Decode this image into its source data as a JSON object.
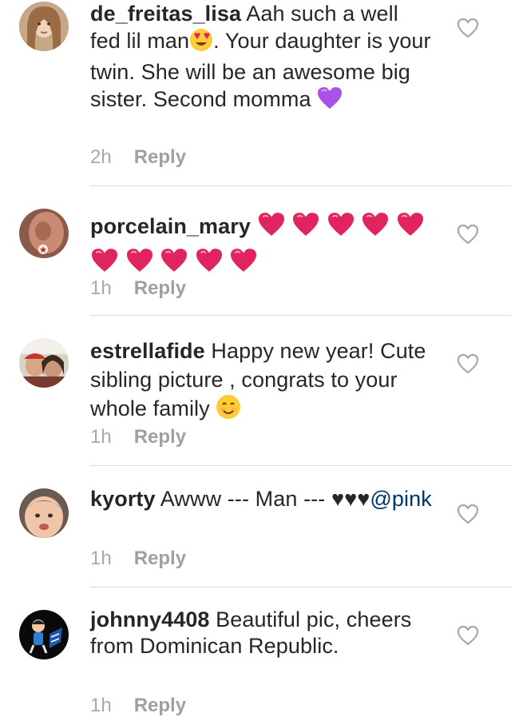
{
  "comments": [
    {
      "username": "de_freitas_lisa",
      "text_1": " Aah such a well fed lil man",
      "emoji_1": "heart-eyes-emoji",
      "text_2": ". Your daughter is your twin. She will be an awesome big sister. Second momma ",
      "emoji_2": "purple-heart-emoji",
      "time": "2h",
      "reply_label": "Reply"
    },
    {
      "username": "porcelain_mary",
      "emoji": "red-heart-emoji",
      "emoji_count": 10,
      "time": "1h",
      "reply_label": "Reply"
    },
    {
      "username": "estrellafide",
      "text": " Happy new year! Cute sibling picture , congrats to your whole family ",
      "emoji": "smiling-face-emoji",
      "time": "1h",
      "reply_label": "Reply"
    },
    {
      "username": "kyorty",
      "text": " Awww --- Man --- ",
      "hearts": "♥♥♥",
      "mention": "@pink",
      "time": "1h",
      "reply_label": "Reply"
    },
    {
      "username": "johnny4408",
      "text": " Beautiful pic, cheers from Dominican Republic.",
      "time": "1h",
      "reply_label": "Reply"
    }
  ],
  "icons": {
    "like": "heart-outline-icon"
  },
  "colors": {
    "text": "#262626",
    "meta": "#a8a8a8",
    "mention": "#003569",
    "divider": "#dbdbdb",
    "red_heart": "#e0245e"
  }
}
